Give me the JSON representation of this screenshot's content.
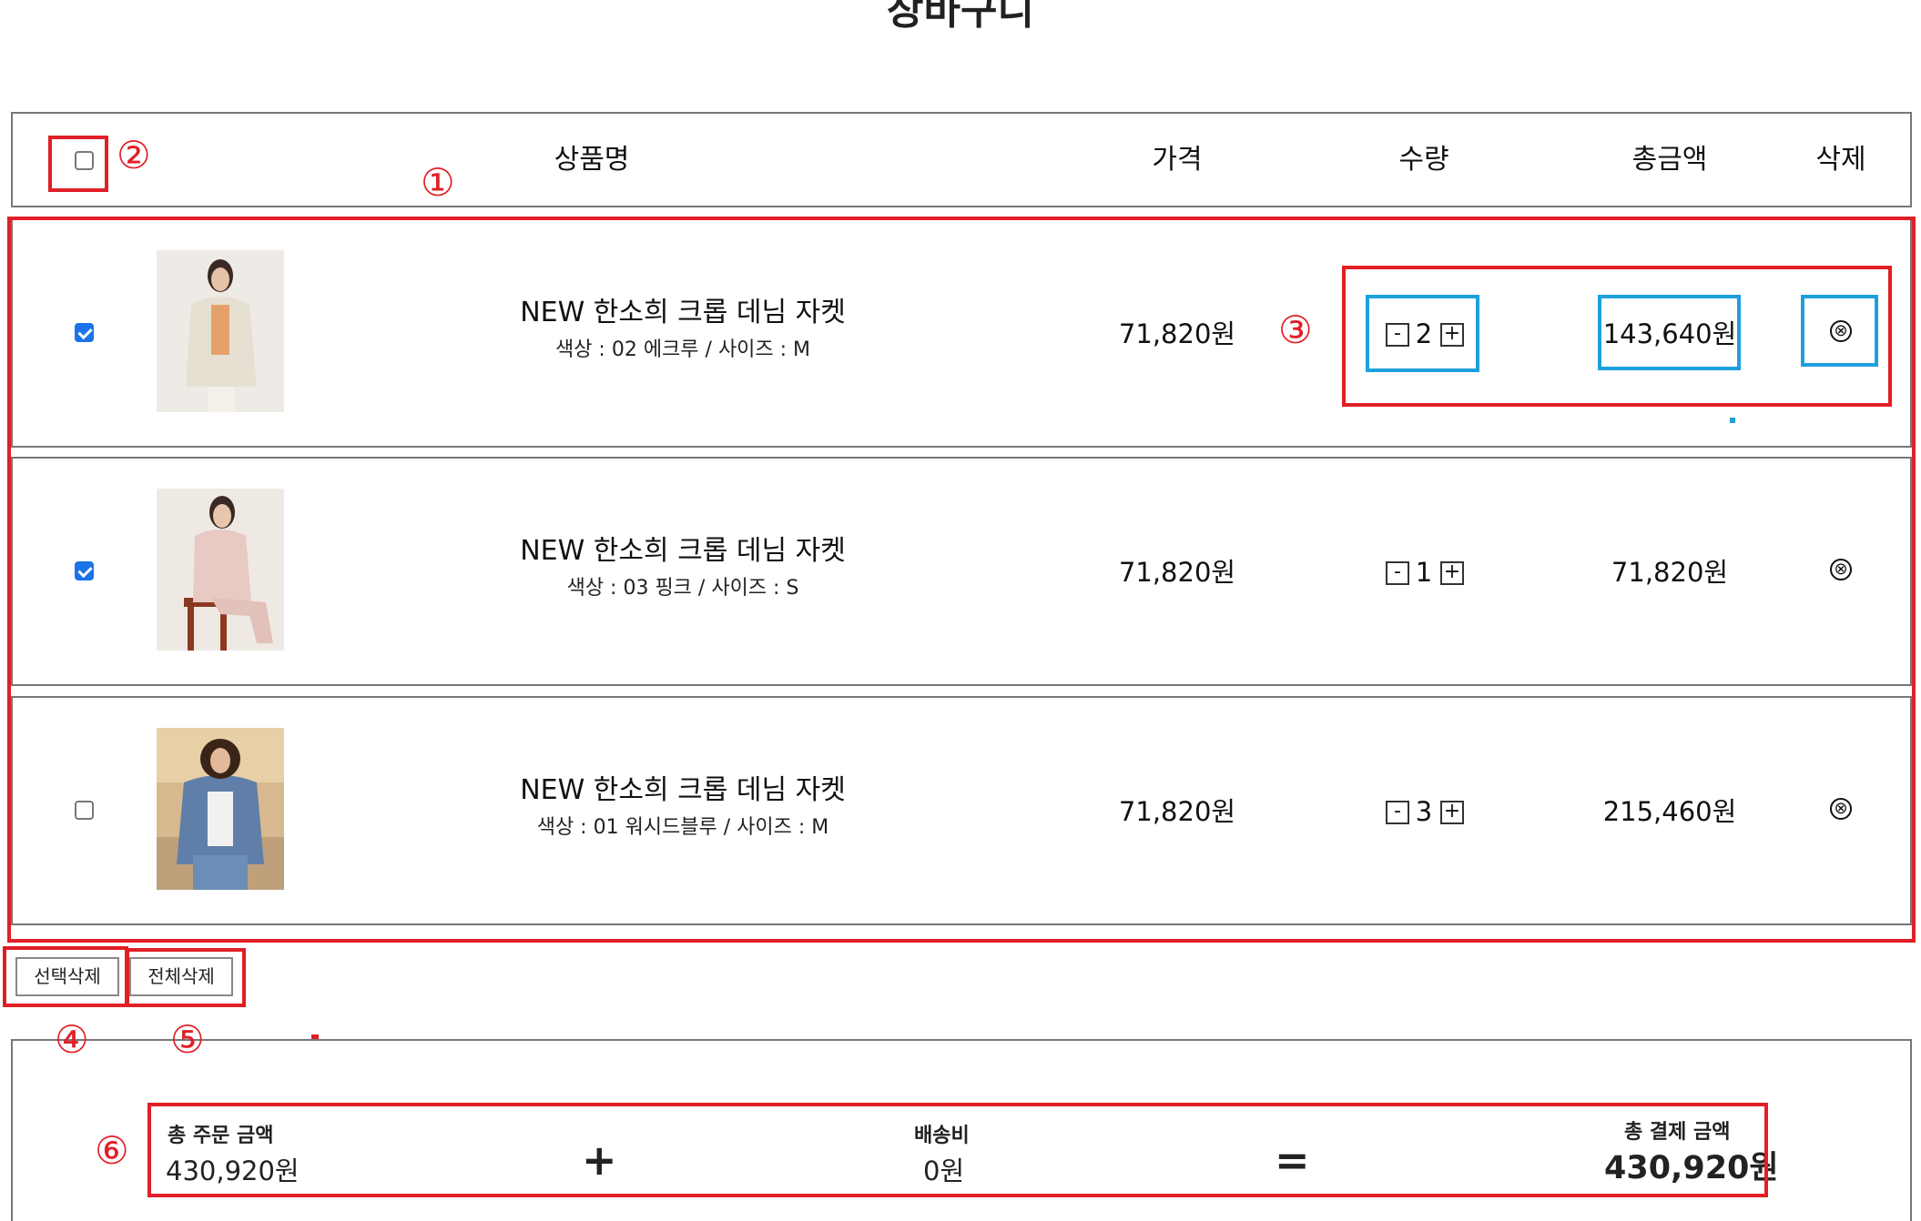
{
  "page_title": "장바구니",
  "header": {
    "product": "상품명",
    "price": "가격",
    "qty": "수량",
    "total": "총금액",
    "delete": "삭제"
  },
  "items": [
    {
      "checked": true,
      "name": "NEW 한소희 크롭 데님 자켓",
      "option": "색상 : 02 에크루 / 사이즈 : M",
      "price": "71,820원",
      "qty": "2",
      "total": "143,640원"
    },
    {
      "checked": true,
      "name": "NEW 한소희 크롭 데님 자켓",
      "option": "색상 : 03 핑크 / 사이즈 : S",
      "price": "71,820원",
      "qty": "1",
      "total": "71,820원"
    },
    {
      "checked": false,
      "name": "NEW 한소희 크롭 데님 자켓",
      "option": "색상 : 01 워시드블루 / 사이즈 : M",
      "price": "71,820원",
      "qty": "3",
      "total": "215,460원"
    }
  ],
  "qty_minus": "-",
  "qty_plus": "+",
  "delete_icon": "⊗",
  "buttons": {
    "delete_selected": "선택삭제",
    "delete_all": "전체삭제"
  },
  "summary": {
    "order_label": "총 주문 금액",
    "order_value": "430,920원",
    "plus": "+",
    "shipping_label": "배송비",
    "shipping_value": "0원",
    "equals": "=",
    "pay_label": "총 결제 금액",
    "pay_value": "430,920원"
  },
  "annotations": [
    "①",
    "②",
    "③",
    "④",
    "⑤",
    "⑥"
  ],
  "colors": {
    "annotation_red": "#e01f26",
    "annotation_blue": "#1ea0dc",
    "checkbox_blue": "#1a73e8"
  }
}
